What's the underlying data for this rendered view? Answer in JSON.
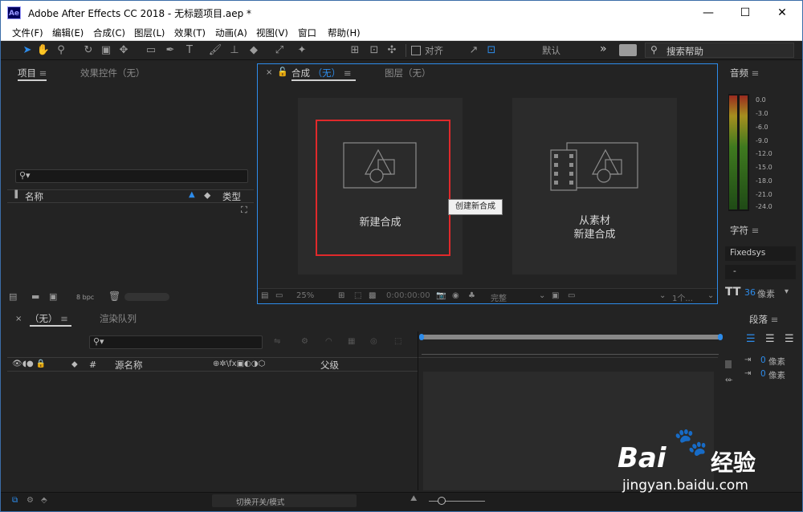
{
  "app": {
    "icon_text": "Ae",
    "title": "Adobe After Effects CC 2018 - 无标题项目.aep *"
  },
  "window_controls": {
    "minimize": "—",
    "maximize": "☐",
    "close": "✕"
  },
  "menu": [
    "文件(F)",
    "编辑(E)",
    "合成(C)",
    "图层(L)",
    "效果(T)",
    "动画(A)",
    "视图(V)",
    "窗口",
    "帮助(H)"
  ],
  "toolbar": {
    "snap_label": "对齐",
    "workspace_label": "默认",
    "more_label": "»",
    "search_placeholder": "搜索帮助"
  },
  "project_panel": {
    "tab_project": "项目",
    "tab_effects": "效果控件（无）",
    "col_name": "名称",
    "col_type": "类型",
    "bpc": "8 bpc"
  },
  "comp_panel": {
    "tab_comp": "合成",
    "tab_comp_value": "（无）",
    "tab_layer": "图层（无）",
    "new_comp_label": "新建合成",
    "from_footage_line1": "从素材",
    "from_footage_line2": "新建合成",
    "tooltip": "创建新合成",
    "zoom": "25%",
    "timecode": "0:00:00:00",
    "resolution": "完整",
    "views": "1个..."
  },
  "audio_panel": {
    "title": "音频",
    "db_levels": [
      "0.0",
      "-3.0",
      "-6.0",
      "-9.0",
      "-12.0",
      "-15.0",
      "-18.0",
      "-21.0",
      "-24.0"
    ]
  },
  "character_panel": {
    "title": "字符",
    "font": "Fixedsys",
    "style": "-",
    "size_value": "36",
    "size_unit": "像素"
  },
  "paragraph_panel": {
    "title": "段落",
    "indent1_value": "0",
    "indent1_unit": "像素",
    "indent2_value": "0",
    "indent2_unit": "像素"
  },
  "timeline_panel": {
    "tab_none": "（无）",
    "tab_render": "渲染队列",
    "col_source": "源名称",
    "col_hash": "#",
    "col_parent": "父级",
    "toggle_label": "切换开关/模式"
  },
  "watermark": {
    "brand": "Bai",
    "brand_cn": "经验",
    "url": "jingyan.baidu.com"
  }
}
